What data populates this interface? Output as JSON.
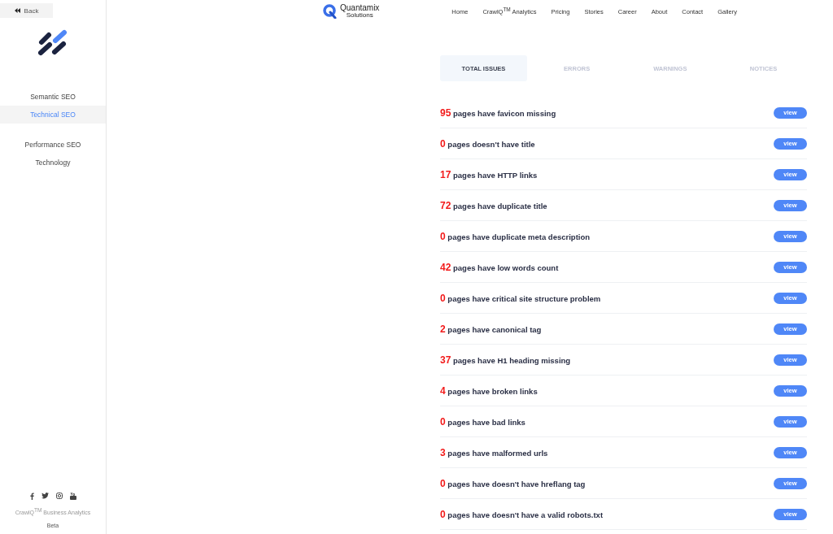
{
  "sidebar": {
    "back": "Back",
    "items": [
      {
        "label": "Semantic SEO",
        "selected": false
      },
      {
        "label": "Technical SEO",
        "selected": true
      }
    ],
    "items_2": [
      {
        "label": "Performance SEO",
        "selected": false
      },
      {
        "label": "Technology",
        "selected": false
      }
    ],
    "footer": {
      "product": "CrawlQ$^{TM}$ Business Analytics",
      "version": "Beta"
    }
  },
  "header": {
    "brand": {
      "name": "Quantamix",
      "subtitle": "Solutions"
    },
    "nav": [
      "Home",
      "CrawlQ$^{TM}$ Analytics",
      "Pricing",
      "Stories",
      "Career",
      "About",
      "Contact",
      "Gallery"
    ]
  },
  "tabs": [
    {
      "label": "TOTAL ISSUES",
      "selected": true
    },
    {
      "label": "ERRORS",
      "selected": false
    },
    {
      "label": "WARNINGS",
      "selected": false
    },
    {
      "label": "NOTICES",
      "selected": false
    }
  ],
  "issues": [
    {
      "count": "95",
      "text": "pages have favicon missing",
      "action": "view"
    },
    {
      "count": "0",
      "text": "pages doesn't have title",
      "action": "view"
    },
    {
      "count": "17",
      "text": "pages have HTTP links",
      "action": "view"
    },
    {
      "count": "72",
      "text": "pages have duplicate title",
      "action": "view"
    },
    {
      "count": "0",
      "text": "pages have duplicate meta description",
      "action": "view"
    },
    {
      "count": "42",
      "text": "pages have low words count",
      "action": "view"
    },
    {
      "count": "0",
      "text": "pages have critical site structure problem",
      "action": "view"
    },
    {
      "count": "2",
      "text": "pages have canonical tag",
      "action": "view"
    },
    {
      "count": "37",
      "text": "pages have H1 heading missing",
      "action": "view"
    },
    {
      "count": "4",
      "text": "pages have broken links",
      "action": "view"
    },
    {
      "count": "0",
      "text": "pages have bad links",
      "action": "view"
    },
    {
      "count": "3",
      "text": "pages have malformed urls",
      "action": "view"
    },
    {
      "count": "0",
      "text": "pages have doesn't have hreflang tag",
      "action": "view"
    },
    {
      "count": "0",
      "text": "pages have doesn't have a valid robots.txt",
      "action": "view"
    }
  ]
}
